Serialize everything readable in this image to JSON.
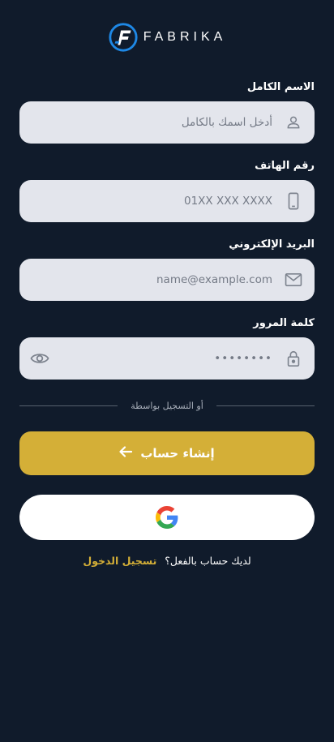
{
  "brand": {
    "name": "FABRIKA"
  },
  "form": {
    "fullname": {
      "label": "الاسم الكامل",
      "placeholder": "أدخل اسمك بالكامل",
      "icon": "user-icon"
    },
    "phone": {
      "label": "رقم الهاتف",
      "placeholder": "01XX XXX XXXX",
      "icon": "phone-icon"
    },
    "email": {
      "label": "البريد الإلكتروني",
      "placeholder": "name@example.com",
      "icon": "mail-icon"
    },
    "password": {
      "label": "كلمة المرور",
      "value": "••••••••",
      "icon": "lock-icon",
      "toggle_icon": "eye-icon"
    }
  },
  "divider": {
    "text": "أو التسجيل بواسطة"
  },
  "actions": {
    "create_account": "إنشاء حساب",
    "google_icon": "google-icon"
  },
  "footer": {
    "question": "لديك حساب بالفعل؟",
    "login_link": "تسجيل الدخول"
  },
  "colors": {
    "background": "#101b2b",
    "field_bg": "#e3e5ec",
    "accent_gold": "#d4af37",
    "brand_blue": "#1e88e5"
  }
}
